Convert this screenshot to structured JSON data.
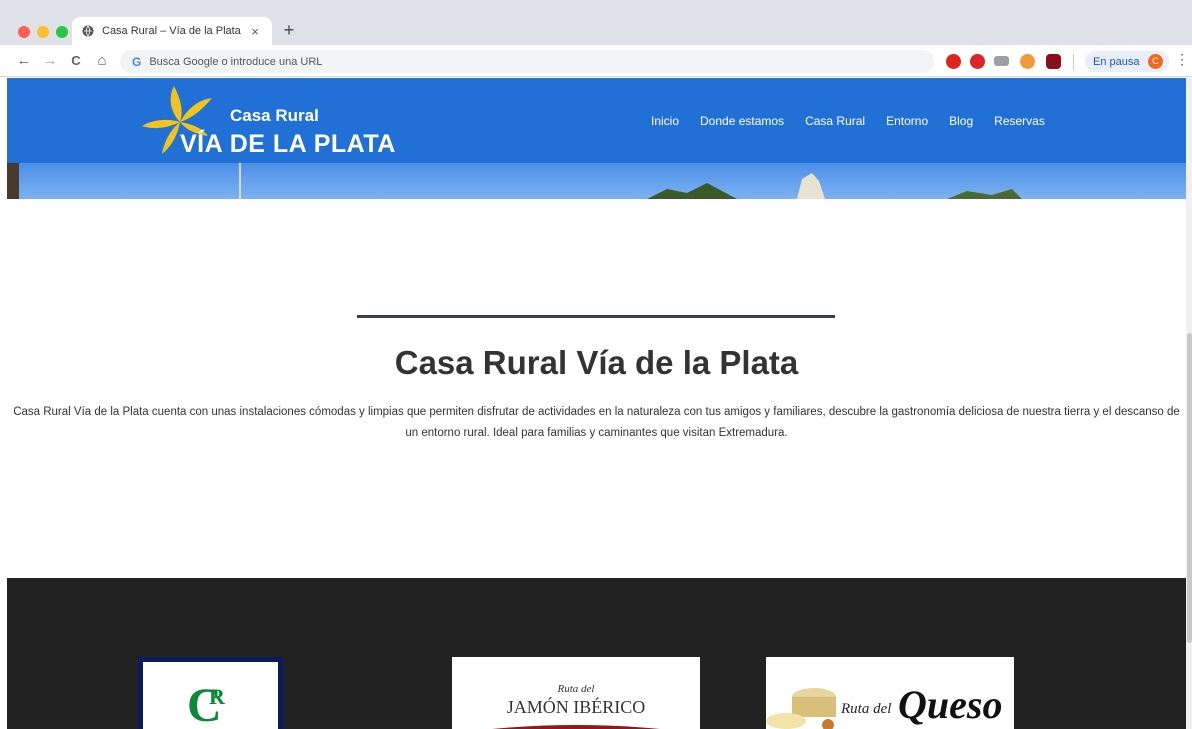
{
  "browser": {
    "tab_title": "Casa Rural – Vía de la Plata",
    "tab_close": "×",
    "new_tab": "+",
    "omnibox_placeholder": "Busca Google o introduce una URL",
    "google_g": "G",
    "profile_label": "En pausa",
    "profile_initial": "C",
    "menu_glyph": "⋮",
    "back_glyph": "←",
    "forward_glyph": "→",
    "reload_glyph": "C",
    "home_glyph": "⌂"
  },
  "site": {
    "logo_line1": "Casa Rural",
    "logo_line2": "VÍA DE LA PLATA",
    "nav": [
      "Inicio",
      "Donde estamos",
      "Casa Rural",
      "Entorno",
      "Blog",
      "Reservas"
    ],
    "heading": "Casa Rural Vía de la Plata",
    "description": "Casa Rural Vía de la Plata cuenta con unas instalaciones cómodas y limpias que permiten disfrutar de actividades en la naturaleza con tus amigos y familiares, descubre la gastronomía deliciosa de nuestra tierra y el descanso de un entorno rural. Ideal para familias y caminantes que visitan Extremadura.",
    "footer_logos": {
      "cr_c": "C",
      "cr_r": "R",
      "jamon_line1": "Ruta del",
      "jamon_line2": "JAMÓN IBÉRICO",
      "queso_line1": "Ruta del",
      "queso_line2": "Queso"
    }
  },
  "colors": {
    "header_blue": "#2170d6",
    "footer_dark": "#222222",
    "logo_yellow": "#f2c31b"
  }
}
